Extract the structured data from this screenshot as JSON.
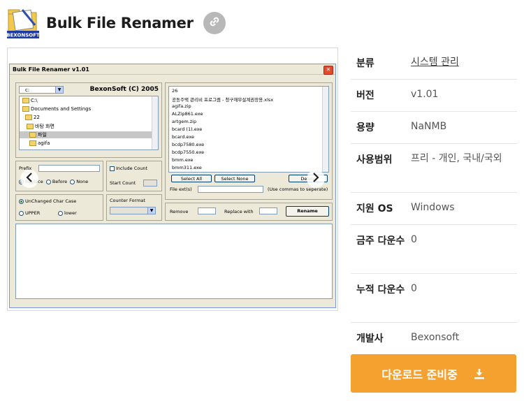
{
  "header": {
    "title": "Bulk File Renamer",
    "logo_label": "BEXONSOFT"
  },
  "screenshot": {
    "window_title": "Bulk File Renamer v1.01",
    "drive": "c:",
    "brand": "BexonSoft (C) 2005",
    "tree": [
      "C:\\",
      "Documents and Settings",
      "22",
      "바탕 화면",
      "파일",
      "agifa"
    ],
    "files": [
      "26",
      "공동주택 관리비 프로그램 - 청구재무설계권장용.xlsx",
      "agifa.zip",
      "ALZip861.exe",
      "artgem.zip",
      "bcard (1).exe",
      "bcard.exe",
      "bcdp7580.exe",
      "bcdp7550.exe",
      "bmm.exe",
      "bmm311.exe"
    ],
    "buttons": {
      "select_all": "Select All",
      "select_none": "Select None",
      "delete": "Delete",
      "rename": "Rename"
    },
    "labels": {
      "prefix": "Prefix",
      "replace": "Replace",
      "before": "Before",
      "none": "None",
      "include_count": "Include Count",
      "start_count": "Start Count",
      "file_ext": "File ext(s)",
      "file_ext_hint": "(Use commas to seperate)",
      "unchanged": "UnChanged Char Case",
      "upper": "UPPER",
      "lower": "lower",
      "counter_format": "Counter Format",
      "remove": "Remove",
      "replace_with": "Replace with"
    }
  },
  "info": {
    "rows": [
      {
        "key": "분류",
        "value": "시스템 관리"
      },
      {
        "key": "버전",
        "value": "v1.01"
      },
      {
        "key": "용량",
        "value": "NaNMB"
      },
      {
        "key": "사용범위",
        "value": "프리 - 개인, 국내/국외"
      },
      {
        "key": "지원 OS",
        "value": "Windows"
      },
      {
        "key": "금주 다운수",
        "value": "0"
      },
      {
        "key": "누적 다운수",
        "value": "0"
      },
      {
        "key": "개발사",
        "value": "Bexonsoft"
      }
    ]
  },
  "download_label": "다운로드 준비중",
  "colors": {
    "accent": "#f5a12f",
    "link_btn": "#b8b8b8"
  },
  "icons": {
    "link": "link-icon",
    "download": "download-icon",
    "prev": "chevron-left-icon",
    "next": "chevron-right-icon"
  }
}
